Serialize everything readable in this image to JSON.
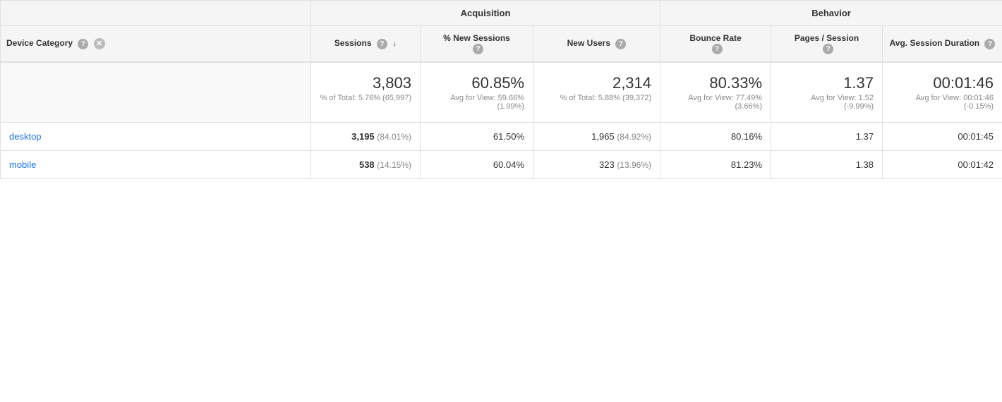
{
  "groups": {
    "acquisition": "Acquisition",
    "behavior": "Behavior"
  },
  "columns": {
    "device_category": "Device Category",
    "sessions": "Sessions",
    "new_sessions": "% New Sessions",
    "new_users": "New Users",
    "bounce_rate": "Bounce Rate",
    "pages_session": "Pages / Session",
    "avg_session": "Avg. Session Duration"
  },
  "totals": {
    "sessions": "3,803",
    "sessions_sub": "% of Total: 5.76% (65,997)",
    "new_sessions": "60.85%",
    "new_sessions_sub": "Avg for View: 59.66% (1.99%)",
    "new_users": "2,314",
    "new_users_sub": "% of Total: 5.88% (39,372)",
    "bounce_rate": "80.33%",
    "bounce_rate_sub": "Avg for View: 77.49% (3.66%)",
    "pages_session": "1.37",
    "pages_session_sub": "Avg for View: 1.52 (-9.99%)",
    "avg_session": "00:01:46",
    "avg_session_sub": "Avg for View: 00:01:46 (-0.15%)"
  },
  "rows": [
    {
      "device": "desktop",
      "sessions": "3,195",
      "sessions_pct": "84.01%",
      "new_sessions": "61.50%",
      "new_users": "1,965",
      "new_users_pct": "84.92%",
      "bounce_rate": "80.16%",
      "pages_session": "1.37",
      "avg_session": "00:01:45"
    },
    {
      "device": "mobile",
      "sessions": "538",
      "sessions_pct": "14.15%",
      "new_sessions": "60.04%",
      "new_users": "323",
      "new_users_pct": "13.96%",
      "bounce_rate": "81.23%",
      "pages_session": "1.38",
      "avg_session": "00:01:42"
    }
  ]
}
